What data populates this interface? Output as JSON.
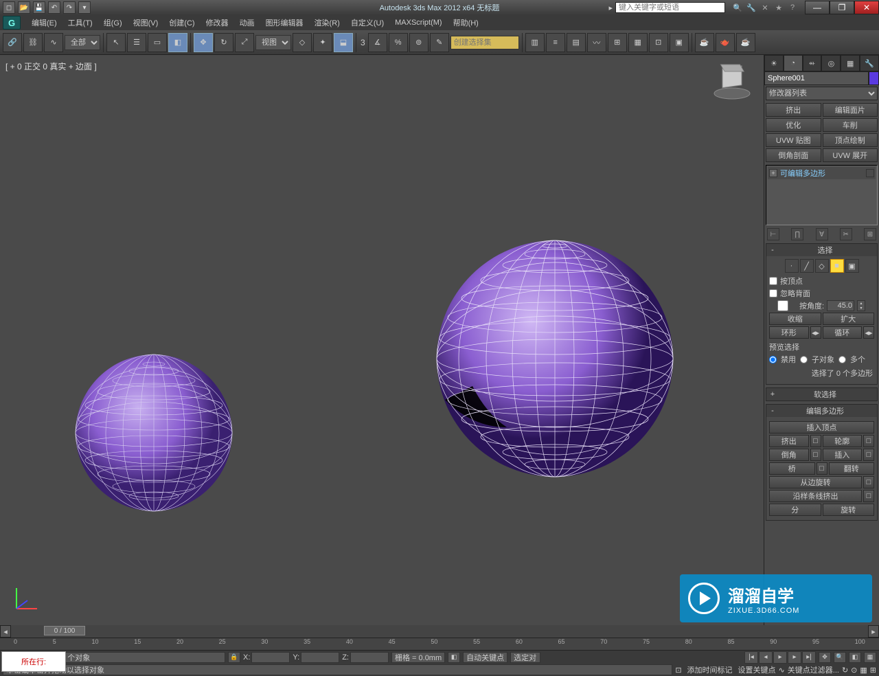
{
  "title": "Autodesk 3ds Max  2012 x64    无标题",
  "search_placeholder": "键入关键字或短语",
  "qat_icons": [
    "new",
    "open",
    "save",
    "undo",
    "redo",
    "menu"
  ],
  "infohub_icons": [
    "binoculars",
    "wrench",
    "star",
    "favorite",
    "help"
  ],
  "wincontrols": {
    "min": "—",
    "max": "❐",
    "close": "✕"
  },
  "menu": [
    "编辑(E)",
    "工具(T)",
    "组(G)",
    "视图(V)",
    "创建(C)",
    "修改器",
    "动画",
    "图形编辑器",
    "渲染(R)",
    "自定义(U)",
    "MAXScript(M)",
    "帮助(H)"
  ],
  "toolbar": {
    "sel_filter": "全部",
    "ref_coord": "视图",
    "sel_set_placeholder": "创建选择集",
    "coord3": "3",
    "icons1": [
      "↶",
      "⟲",
      "⟳"
    ],
    "icons2": [
      "▭",
      "◫",
      "◧",
      "◨"
    ],
    "icons3": [
      "⊕",
      "↻",
      "⤢",
      "◧"
    ],
    "icons4": [
      "◇",
      "⊡"
    ],
    "icons5": [
      "∡",
      "%",
      "⬓",
      "⊗",
      "✎"
    ],
    "icons6": [
      "▦",
      "▤",
      "|",
      "≡",
      "⊞",
      "⊠",
      "▦",
      "⊡",
      "⊞",
      "▤",
      "⊡",
      "⊞",
      "⊡",
      "◧",
      "⬓"
    ]
  },
  "viewport": {
    "label": "[ + 0 正交 0 真实 + 边面 ]"
  },
  "cmdpanel": {
    "tabs": [
      "☀",
      "◔",
      "⬡",
      "◎",
      "▦",
      "✎"
    ],
    "obj_name": "Sphere001",
    "modlist": "修改器列表",
    "btns": [
      "挤出",
      "编辑面片",
      "优化",
      "车削",
      "UVW 贴图",
      "顶点绘制",
      "倒角剖面",
      "UVW 展开"
    ],
    "stack_item": "可编辑多边形",
    "stacktools": [
      "⊢",
      "⊣",
      "∘",
      "∘",
      "⊞"
    ]
  },
  "rollouts": {
    "selection": {
      "title": "选择",
      "subicons": [
        ".",
        "/",
        "▭",
        "■",
        "▣"
      ],
      "by_vertex": "按顶点",
      "ignore_backfacing": "忽略背面",
      "by_angle": "按角度:",
      "angle_value": "45.0",
      "shrink": "收缩",
      "grow": "扩大",
      "ring": "环形",
      "loop": "循环",
      "preview_label": "预览选择",
      "preview_options": [
        "禁用",
        "子对象",
        "多个"
      ],
      "status": "选择了 0 个多边形"
    },
    "soft": {
      "title": "软选择"
    },
    "edit_poly": {
      "title": "编辑多边形",
      "insert_vertex": "插入顶点",
      "extrude": "挤出",
      "outline": "轮廓",
      "bevel": "倒角",
      "inset": "插入",
      "bridge": "桥",
      "flip": "翻转",
      "hinge": "从边旋转",
      "extrude_spline": "沿样条线挤出",
      "part1": "分",
      "part2": "旋转"
    }
  },
  "timeslider": {
    "value": "0 / 100"
  },
  "ticks": [
    "0",
    "5",
    "10",
    "15",
    "20",
    "25",
    "30",
    "35",
    "40",
    "45",
    "50",
    "55",
    "60",
    "65",
    "70",
    "75",
    "80",
    "85",
    "90",
    "95",
    "100"
  ],
  "status": {
    "sel_text": "选择了 1 个对象",
    "x": "X:",
    "y": "Y:",
    "z": "Z:",
    "grid": "栅格 = 0.0mm",
    "autokey": "自动关键点",
    "selected": "选定对",
    "setkey": "设置关键点",
    "keyfilter": "关键点过滤器...",
    "prompt": "单击或单击并拖动以选择对象",
    "addtime": "添加时间标记",
    "location_lbl": "所在行:"
  },
  "watermark": {
    "cn": "溜溜自学",
    "en": "ZIXUE.3D66.COM"
  }
}
